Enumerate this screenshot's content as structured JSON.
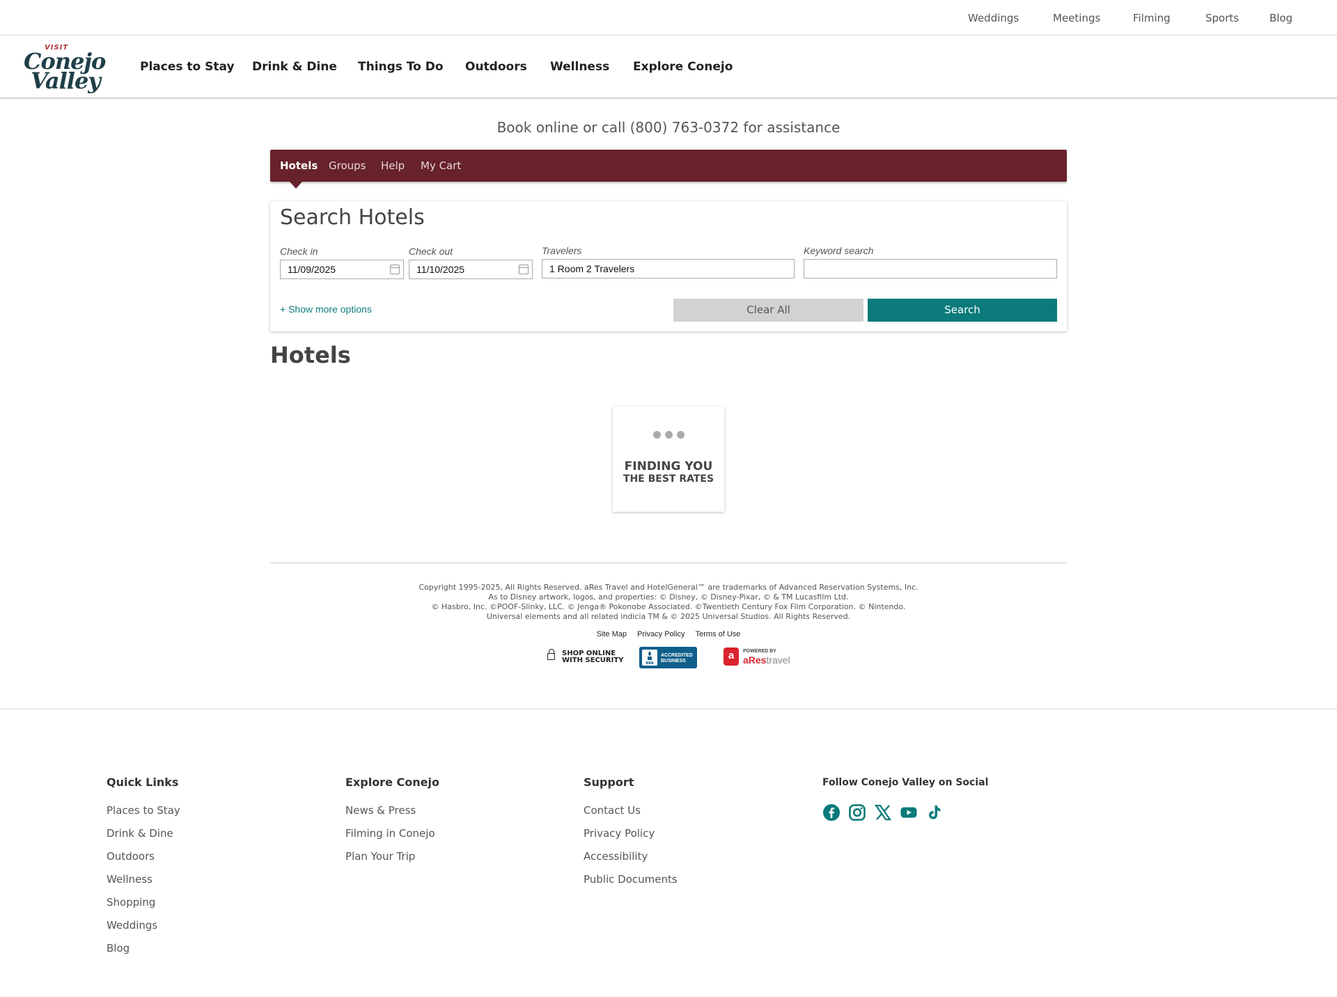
{
  "utility_nav": [
    "Weddings",
    "Meetings",
    "Filming",
    "Sports",
    "Blog"
  ],
  "logo": {
    "visit": "VISIT",
    "line1": "Conejo",
    "line2": "Valley"
  },
  "main_nav": [
    "Places to Stay",
    "Drink & Dine",
    "Things To Do",
    "Outdoors",
    "Wellness",
    "Explore Conejo"
  ],
  "booking": {
    "phone_line": "Book online or call (800) 763-0372 for assistance",
    "tabs": [
      "Hotels",
      "Groups",
      "Help",
      "My Cart"
    ],
    "active_tab": "Hotels",
    "search_title": "Search Hotels",
    "checkin_label": "Check in",
    "checkin_value": "11/09/2025",
    "checkout_label": "Check out",
    "checkout_value": "11/10/2025",
    "travelers_label": "Travelers",
    "travelers_value": "1 Room 2 Travelers",
    "keyword_label": "Keyword search",
    "keyword_value": "",
    "more_options": "+ Show more options",
    "clear_label": "Clear All",
    "search_label": "Search"
  },
  "results": {
    "title": "Hotels",
    "loading_line1": "FINDING YOU",
    "loading_line2": "THE BEST RATES"
  },
  "legal": {
    "copyright": [
      "Copyright 1995-2025, All Rights Reserved. aRes Travel and HotelGeneral™ are trademarks of Advanced Reservation Systems, Inc.",
      "As to Disney artwork, logos, and properties: © Disney, © Disney-Pixar, © & TM Lucasfilm Ltd.",
      "© Hasbro, Inc. ©POOF-Slinky, LLC. © Jenga® Pokonobe Associated. ©Twentieth Century Fox Film Corporation. © Nintendo.",
      "Universal elements and all related indicia TM & © 2025 Universal Studios. All Rights Reserved."
    ],
    "links": [
      "Site Map",
      "Privacy Policy",
      "Terms of Use"
    ],
    "badge_shop_line1": "SHOP ONLINE",
    "badge_shop_line2": "WITH SECURITY",
    "badge_bbb_line1": "ACCREDITED",
    "badge_bbb_line2": "BUSINESS",
    "badge_bbb_mark": "BBB",
    "badge_ares_powered": "POWERED BY",
    "badge_ares_logo": "a",
    "badge_ares_brand1": "aRes",
    "badge_ares_brand2": "travel"
  },
  "footer": {
    "quick_links": {
      "heading": "Quick Links",
      "items": [
        "Places to Stay",
        "Drink & Dine",
        "Outdoors",
        "Wellness",
        "Shopping",
        "Weddings",
        "Blog"
      ]
    },
    "explore": {
      "heading": "Explore Conejo",
      "items": [
        "News & Press",
        "Filming in Conejo",
        "Plan Your Trip"
      ]
    },
    "support": {
      "heading": "Support",
      "items": [
        "Contact Us",
        "Privacy Policy",
        "Accessibility",
        "Public Documents"
      ]
    },
    "social": {
      "heading": "Follow Conejo Valley on Social",
      "icons": [
        "facebook-icon",
        "instagram-icon",
        "x-icon",
        "youtube-icon",
        "tiktok-icon"
      ]
    }
  },
  "colors": {
    "brand_maroon": "#67222b",
    "accent_teal": "#0a7a7a",
    "logo_navy": "#1f3f48"
  }
}
